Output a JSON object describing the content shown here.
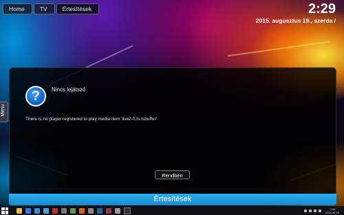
{
  "breadcrumbs": [
    "Home",
    "TV",
    "Értesítések"
  ],
  "clock": {
    "time": "2:29",
    "date": "2015. augusztus 19., szerda /"
  },
  "side_menu": {
    "label": "Menu"
  },
  "dialog": {
    "title": "Nincs lejátszó",
    "message": "There is no player registered to play media item 'live2-0.ts.tsbuffer'",
    "ok_label": "Rendben",
    "icon": "info-icon"
  },
  "footer": {
    "label": "Értesítések",
    "color": "#1e9fe0"
  },
  "taskbar": {
    "icons": [
      "file-explorer-icon",
      "edge-icon",
      "store-icon",
      "mail-icon",
      "app-icon",
      "media-icon",
      "app-icon",
      "app-icon",
      "app-icon",
      "app-icon",
      "app-icon",
      "app-icon",
      "app-icon"
    ],
    "tray_time": "2:29",
    "tray_date": "2015.08.19."
  }
}
